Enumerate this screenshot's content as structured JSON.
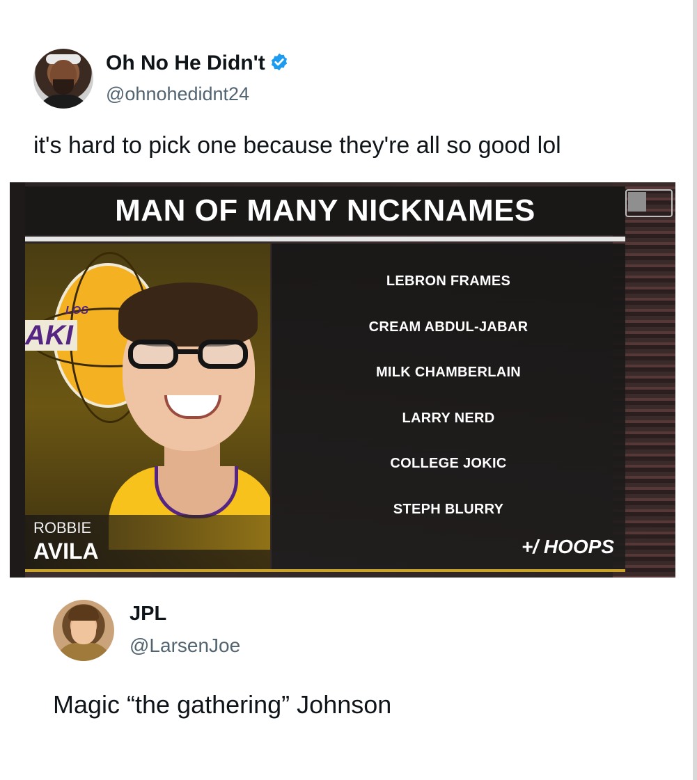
{
  "tweet1": {
    "author_name": "Oh No He Didn't",
    "handle": "@ohnohedidnt24",
    "verified": true,
    "text": "it's hard to pick one because they're all so good lol"
  },
  "graphic": {
    "title": "MAN OF MANY NICKNAMES",
    "logo_text": "LOS",
    "logo_text_large": "AKI",
    "player_first_name": "ROBBIE",
    "player_last_name": "AVILA",
    "nicknames": [
      "LEBRON FRAMES",
      "CREAM ABDUL-JABAR",
      "MILK CHAMBERLAIN",
      "LARRY NERD",
      "COLLEGE JOKIC",
      "STEPH BLURRY"
    ],
    "brand": "+/ HOOPS",
    "colors": {
      "lakers_purple": "#552583",
      "lakers_gold": "#f4b223",
      "accent_line": "#c9a227"
    }
  },
  "tweet2": {
    "author_name": "JPL",
    "handle": "@LarsenJoe",
    "text": "Magic “the gathering” Johnson"
  },
  "icons": {
    "verified": "verified-badge-icon",
    "league_logo": "nba-logo-icon"
  }
}
